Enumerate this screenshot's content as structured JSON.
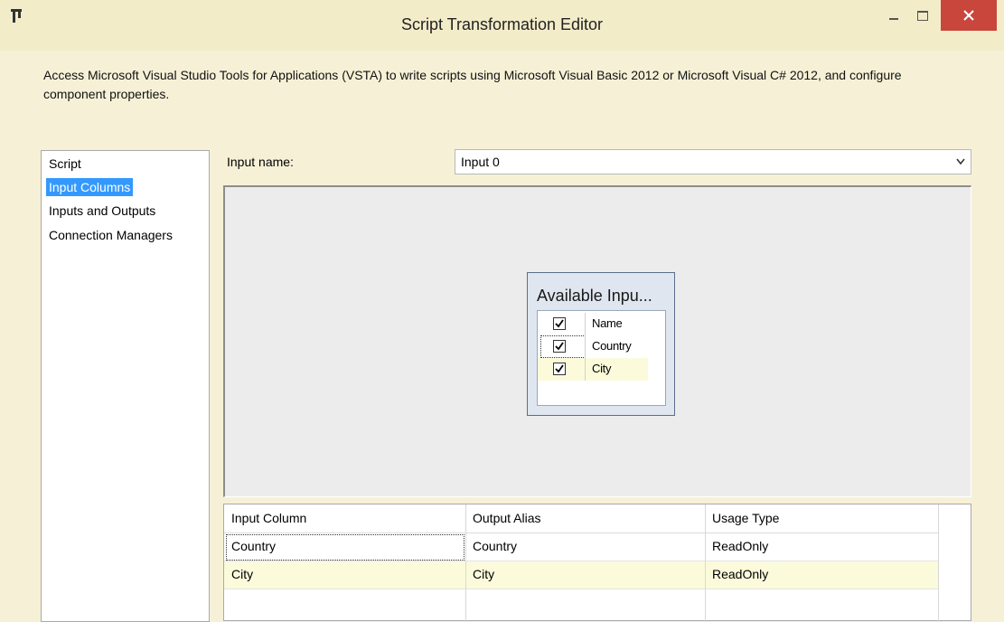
{
  "window": {
    "title": "Script Transformation Editor",
    "colors": {
      "titlebar": "#f3ecc9",
      "close": "#c9463d",
      "selection": "#3399ff",
      "row_highlight": "#fbfbdc"
    }
  },
  "description": "Access Microsoft Visual Studio Tools for Applications (VSTA) to write scripts using Microsoft Visual Basic 2012 or Microsoft Visual C# 2012, and configure component properties.",
  "nav": {
    "items": [
      {
        "label": "Script",
        "selected": false
      },
      {
        "label": "Input Columns",
        "selected": true
      },
      {
        "label": "Inputs and Outputs",
        "selected": false
      },
      {
        "label": "Connection Managers",
        "selected": false
      }
    ]
  },
  "input": {
    "label": "Input name:",
    "value": "Input 0"
  },
  "available_columns": {
    "title": "Available Inpu...",
    "rows": [
      {
        "name": "Name",
        "checked": true
      },
      {
        "name": "Country",
        "checked": true
      },
      {
        "name": "City",
        "checked": true
      }
    ]
  },
  "grid": {
    "headers": [
      "Input Column",
      "Output Alias",
      "Usage Type"
    ],
    "rows": [
      {
        "input_column": "Country",
        "output_alias": "Country",
        "usage_type": "ReadOnly"
      },
      {
        "input_column": "City",
        "output_alias": "City",
        "usage_type": "ReadOnly"
      }
    ]
  },
  "icons": [
    "app-icon",
    "minimize-icon",
    "maximize-icon",
    "close-icon",
    "chevron-down-icon",
    "checkbox-checked-icon"
  ]
}
